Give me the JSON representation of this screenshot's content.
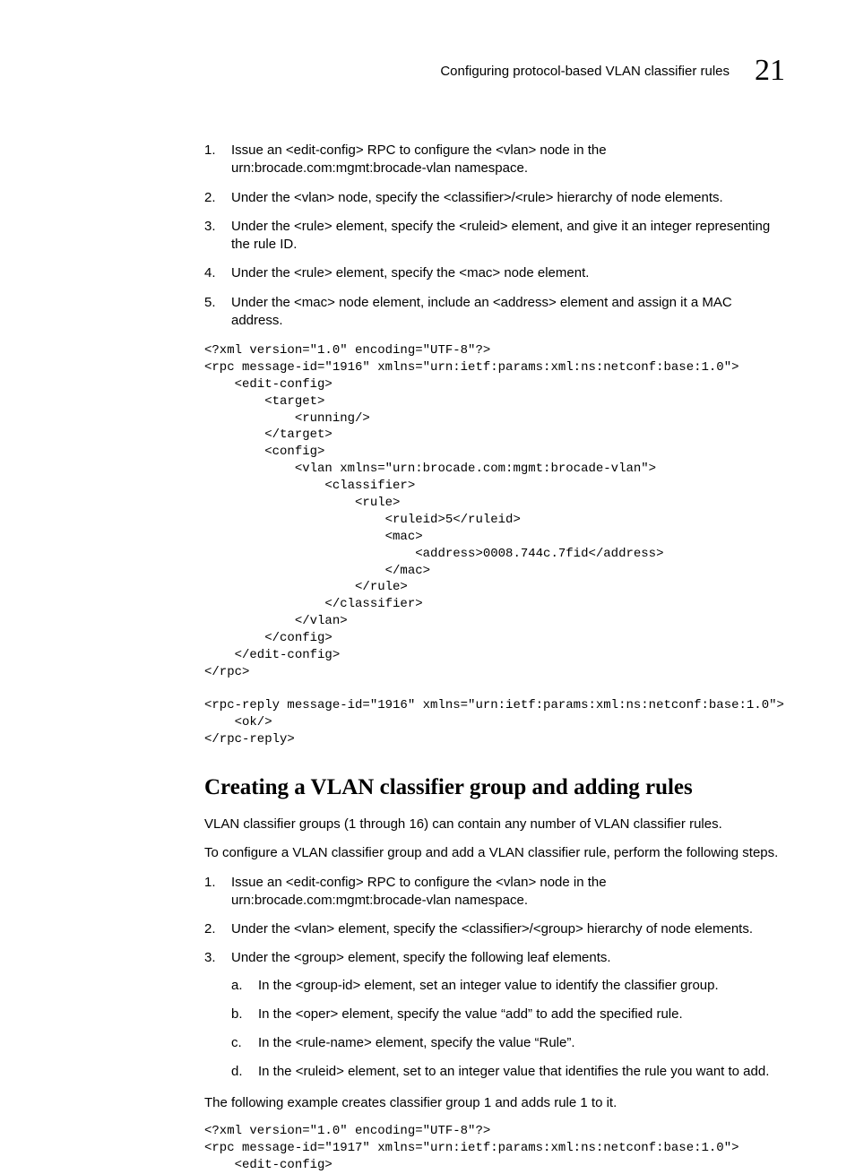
{
  "header": {
    "running_title": "Configuring protocol-based VLAN classifier rules",
    "chapter_number": "21"
  },
  "steps1": [
    "Issue an <edit-config> RPC to configure the <vlan> node in the urn:brocade.com:mgmt:brocade-vlan namespace.",
    "Under the <vlan> node, specify the <classifier>/<rule> hierarchy of node elements.",
    "Under the <rule> element, specify the <ruleid> element, and give it an integer representing the rule ID.",
    "Under the <rule> element, specify the <mac> node element.",
    "Under the <mac> node element, include an <address> element and assign it a MAC address."
  ],
  "code1": "<?xml version=\"1.0\" encoding=\"UTF-8\"?>\n<rpc message-id=\"1916\" xmlns=\"urn:ietf:params:xml:ns:netconf:base:1.0\">\n    <edit-config>\n        <target>\n            <running/>\n        </target>\n        <config>\n            <vlan xmlns=\"urn:brocade.com:mgmt:brocade-vlan\">\n                <classifier>\n                    <rule>\n                        <ruleid>5</ruleid>\n                        <mac>\n                            <address>0008.744c.7fid</address>\n                        </mac>\n                    </rule>\n                </classifier>\n            </vlan>\n        </config>\n    </edit-config>\n</rpc>",
  "code1b": "<rpc-reply message-id=\"1916\" xmlns=\"urn:ietf:params:xml:ns:netconf:base:1.0\">\n    <ok/>\n</rpc-reply>",
  "section2": {
    "title": "Creating a VLAN classifier group and adding rules",
    "intro1": "VLAN classifier groups (1 through 16) can contain any number of VLAN classifier rules.",
    "intro2": "To configure a VLAN classifier group and add a VLAN classifier rule, perform the following steps."
  },
  "steps2": [
    {
      "text": "Issue an <edit-config> RPC to configure the <vlan> node in the urn:brocade.com:mgmt:brocade-vlan namespace."
    },
    {
      "text": "Under the <vlan> element, specify the <classifier>/<group> hierarchy of node elements."
    },
    {
      "text": "Under the <group> element, specify the following leaf elements.",
      "sub": [
        "In the <group-id> element, set an integer value to identify the classifier group.",
        "In the <oper> element, specify the value “add” to add the specified rule.",
        "In the <rule-name> element, specify the value “Rule”.",
        "In the <ruleid> element, set to an integer value that identifies the rule you want to add."
      ]
    }
  ],
  "section2_outro": "The following example creates classifier group 1 and adds rule 1 to it.",
  "code2": "<?xml version=\"1.0\" encoding=\"UTF-8\"?>\n<rpc message-id=\"1917\" xmlns=\"urn:ietf:params:xml:ns:netconf:base:1.0\">\n    <edit-config>"
}
